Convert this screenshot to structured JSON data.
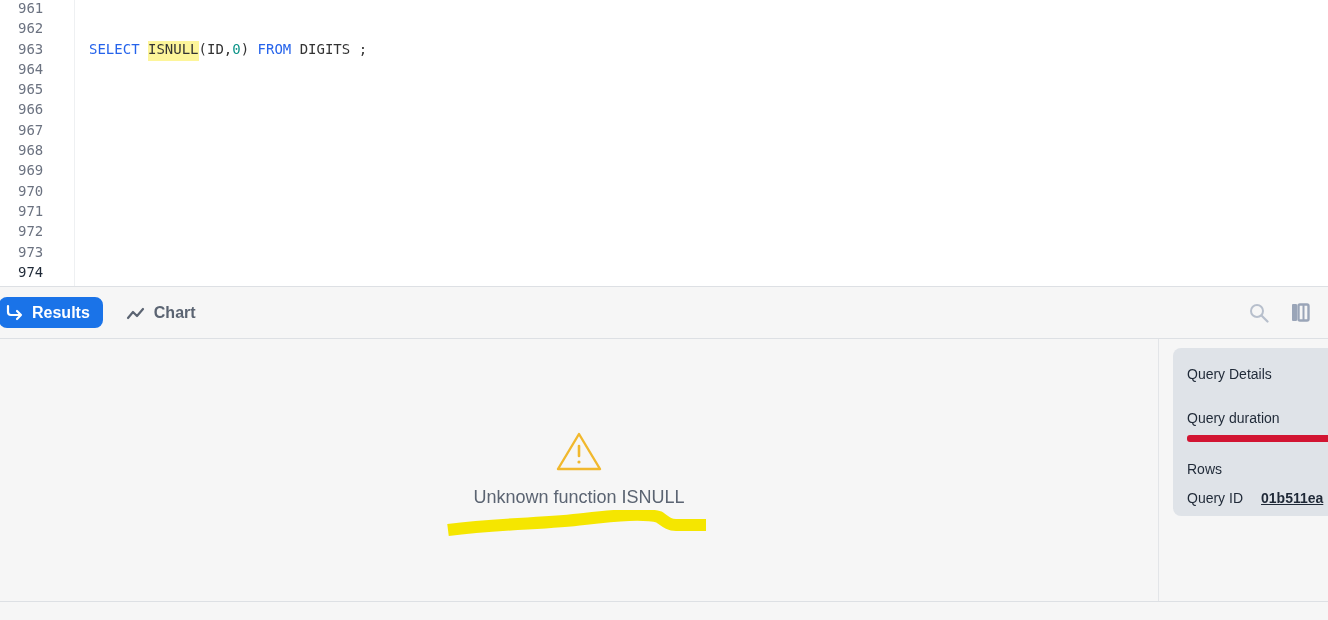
{
  "editor": {
    "lines": [
      {
        "number": "961",
        "current": false
      },
      {
        "number": "962",
        "current": false
      },
      {
        "number": "963",
        "current": false,
        "tokens": [
          {
            "text": "SELECT",
            "kind": "keyword",
            "highlighted": false
          },
          {
            "text": "ISNULL",
            "kind": "function",
            "highlighted": true
          },
          {
            "text": "(ID,",
            "kind": "plain",
            "highlighted": false
          },
          {
            "text": "0",
            "kind": "number",
            "highlighted": false
          },
          {
            "text": ")",
            "kind": "plain",
            "highlighted": false
          },
          {
            "text": "FROM",
            "kind": "keyword",
            "highlighted": false
          },
          {
            "text": "DIGITS ;",
            "kind": "plain",
            "highlighted": false
          }
        ]
      },
      {
        "number": "964",
        "current": false
      },
      {
        "number": "965",
        "current": false
      },
      {
        "number": "966",
        "current": false
      },
      {
        "number": "967",
        "current": false
      },
      {
        "number": "968",
        "current": false
      },
      {
        "number": "969",
        "current": false
      },
      {
        "number": "970",
        "current": false
      },
      {
        "number": "971",
        "current": false
      },
      {
        "number": "972",
        "current": false
      },
      {
        "number": "973",
        "current": false
      },
      {
        "number": "974",
        "current": true
      }
    ]
  },
  "tabs": [
    {
      "label": "Results",
      "selected": true
    },
    {
      "label": "Chart",
      "selected": false
    }
  ],
  "error": {
    "message": "Unknown function ISNULL"
  },
  "query_details": {
    "title": "Query Details",
    "duration_label": "Query duration",
    "rows_label": "Rows",
    "query_id_label": "Query ID",
    "query_id": "01b511ea"
  }
}
